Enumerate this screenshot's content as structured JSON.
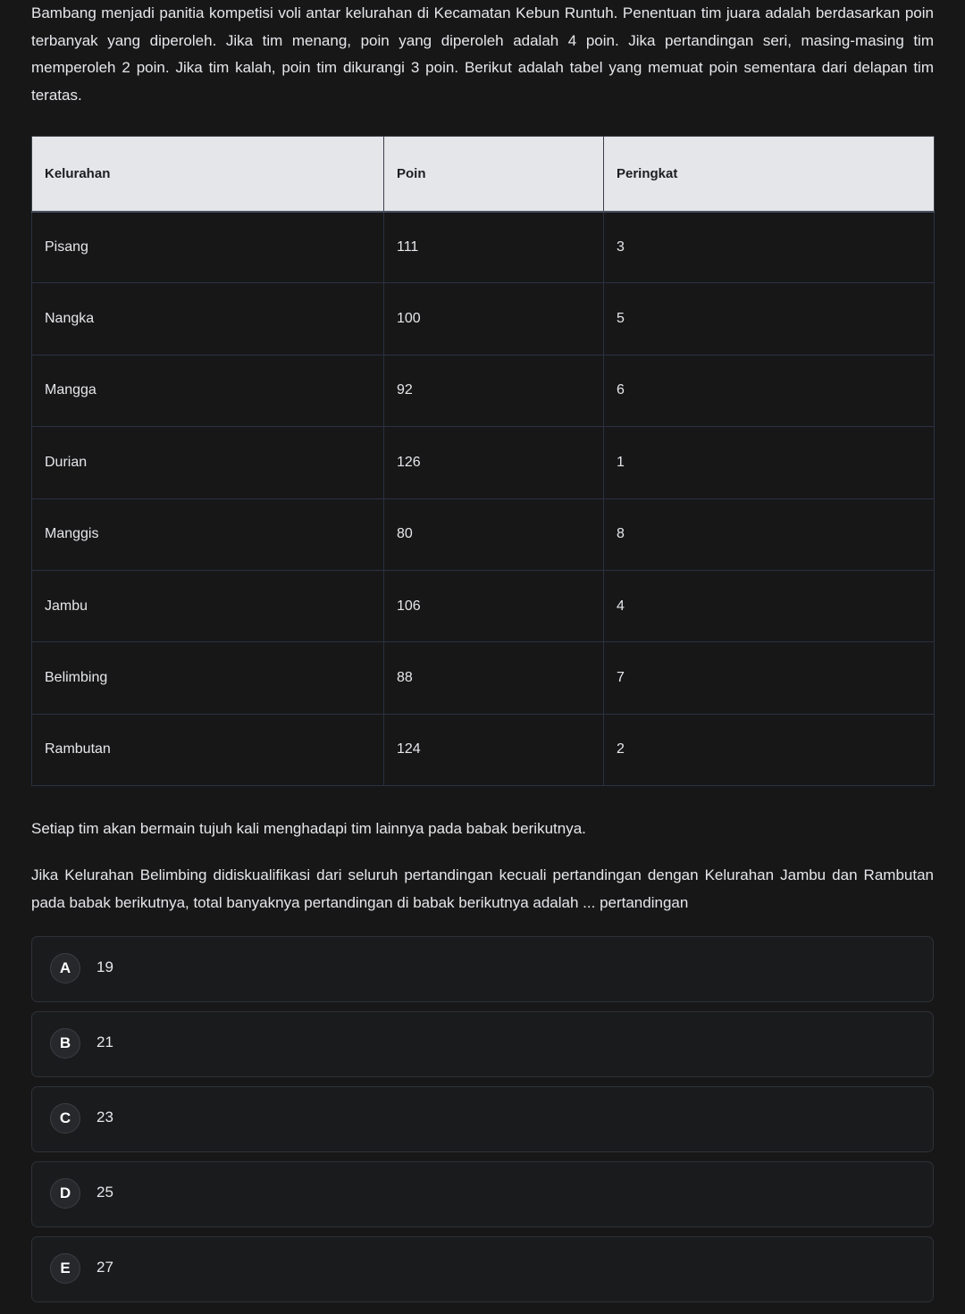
{
  "question": {
    "intro": "Bambang menjadi panitia kompetisi voli antar kelurahan di Kecamatan Kebun Runtuh. Penentuan tim juara adalah berdasarkan poin terbanyak yang diperoleh. Jika tim menang, poin yang diperoleh adalah 4 poin. Jika pertandingan seri, masing-masing tim memperoleh 2 poin. Jika tim kalah, poin tim dikurangi 3 poin. Berikut adalah tabel yang memuat poin sementara dari delapan tim teratas.",
    "line1": "Setiap tim akan bermain tujuh kali menghadapi tim lainnya pada babak berikutnya.",
    "line2": "Jika Kelurahan Belimbing didiskualifikasi dari seluruh pertandingan kecuali pertandingan dengan Kelurahan Jambu dan Rambutan pada babak berikutnya, total banyaknya pertandingan di babak berikutnya adalah ... pertandingan"
  },
  "table": {
    "headers": [
      "Kelurahan",
      "Poin",
      "Peringkat"
    ],
    "rows": [
      [
        "Pisang",
        "111",
        "3"
      ],
      [
        "Nangka",
        "100",
        "5"
      ],
      [
        "Mangga",
        "92",
        "6"
      ],
      [
        "Durian",
        "126",
        "1"
      ],
      [
        "Manggis",
        "80",
        "8"
      ],
      [
        "Jambu",
        "106",
        "4"
      ],
      [
        "Belimbing",
        "88",
        "7"
      ],
      [
        "Rambutan",
        "124",
        "2"
      ]
    ]
  },
  "options": [
    {
      "letter": "A",
      "text": "19"
    },
    {
      "letter": "B",
      "text": "21"
    },
    {
      "letter": "C",
      "text": "23"
    },
    {
      "letter": "D",
      "text": "25"
    },
    {
      "letter": "E",
      "text": "27"
    }
  ],
  "colors": {
    "background": "#171718",
    "header_bg": "#e4e6ea",
    "text": "#e6e7ea"
  }
}
